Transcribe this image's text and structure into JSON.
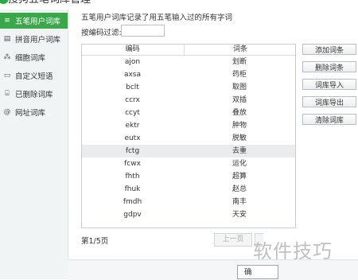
{
  "window": {
    "title": "搜狗五笔词库管理"
  },
  "sidebar": {
    "items": [
      {
        "label": "五笔用户词库",
        "icon": "≡"
      },
      {
        "label": "拼音用户词库",
        "icon": "▤"
      },
      {
        "label": "细胞词库",
        "icon": "⁂"
      },
      {
        "label": "自定义短语",
        "icon": "▭"
      },
      {
        "label": "已删除词库",
        "icon": "⌸"
      },
      {
        "label": "网址词库",
        "icon": "@"
      }
    ]
  },
  "main": {
    "description": "五笔用户词库记录了用五笔输入过的所有字词",
    "filter": {
      "label": "按编码过滤:",
      "value": ""
    },
    "table": {
      "columns": [
        "编码",
        "词条"
      ],
      "rows": [
        [
          "ajon",
          "划断"
        ],
        [
          "axsa",
          "药柜"
        ],
        [
          "bclt",
          "取图"
        ],
        [
          "ccrx",
          "双插"
        ],
        [
          "ccyt",
          "叠放"
        ],
        [
          "ektr",
          "肿物"
        ],
        [
          "eutx",
          "脱敏"
        ],
        [
          "fctg",
          "去重"
        ],
        [
          "fcwx",
          "运化"
        ],
        [
          "fhth",
          "超算"
        ],
        [
          "fhuk",
          "赵总"
        ],
        [
          "fmdh",
          "南丰"
        ],
        [
          "gdpv",
          "天安"
        ]
      ]
    },
    "buttons": {
      "add": "添加词条",
      "delete": "删除词条",
      "import": "词库导入",
      "export": "词库导出",
      "clear": "清除词库"
    },
    "pagination": {
      "page_info": "第1/5页",
      "prev": "上一页"
    }
  },
  "footer": {
    "ok": "确"
  },
  "watermark": "软件技巧",
  "colors": {
    "accent": "#3aa74a",
    "selected_row": "#e9ecef"
  }
}
